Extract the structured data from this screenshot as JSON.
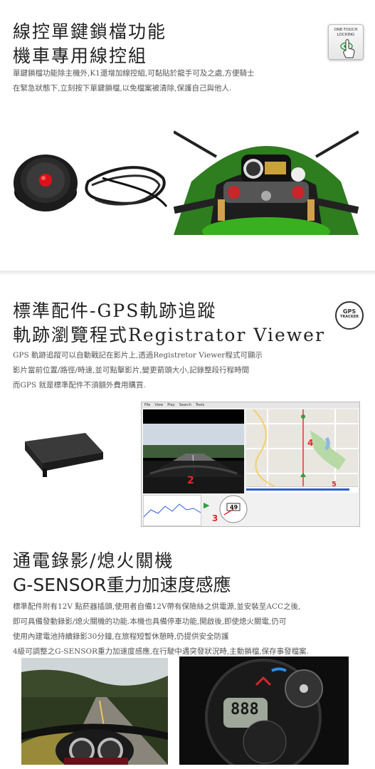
{
  "section1": {
    "title_line1": "線控單鍵鎖檔功能",
    "title_line2": "機車專用線控組",
    "badge_line1": "ONE-TOUCH",
    "badge_line2": "LOCKING",
    "desc_line1": "單鍵鎖檔功能除主機外,K1還增加線控組,可黏貼於龍手可及之處,方便騎士",
    "desc_line2": "在緊急狀態下,立刻按下單鍵鎖檔,以免檔案被清除,保護自己與他人."
  },
  "section2": {
    "title_line1": "標準配件-GPS軌跡追蹤",
    "title_line2": "軌跡瀏覽程式Registrator Viewer",
    "badge_line1": "GPS",
    "badge_line2": "TRACKER",
    "desc_line1": "GPS 軌跡追蹤可以自動戰記在影片上,透過Registretor Viewer程式可顯示",
    "desc_line2": "影片當前位置/路徑/時速,並可點擊影片,變更箭頭大小,記錄整段行程時間",
    "desc_line3": "而GPS 就是標準配件不須額外費用購買.",
    "viewer": {
      "menu": [
        "File",
        "View",
        "Play",
        "Search",
        "Tools"
      ],
      "label_2": "2",
      "label_3": "3",
      "label_4": "4",
      "label_5": "5",
      "speed": "49"
    }
  },
  "section3": {
    "title_line1": "通電錄影/熄火關機",
    "title_line2": "G-SENSOR重力加速度感應",
    "desc_line1": "標準配件附有12V 點菸器插頭,使用者自備12V帶有保險絲之供電源,並安裝至ACC之後,",
    "desc_line2": "即可具備發動錄影/熄火關機的功能.本機也具備停車功能,開啟後,即使熄火關電,仍可",
    "desc_line3": "使用內建電池持續錄影30分鐘,在旅程短暫休憩時,仍提供安全防護",
    "desc_line4": "4級可調整之G-SENSOR重力加速度感應,在行駛中遇突發狀況時,主動鎖檔,保存事發檔案.",
    "gauge_digits": "888"
  }
}
